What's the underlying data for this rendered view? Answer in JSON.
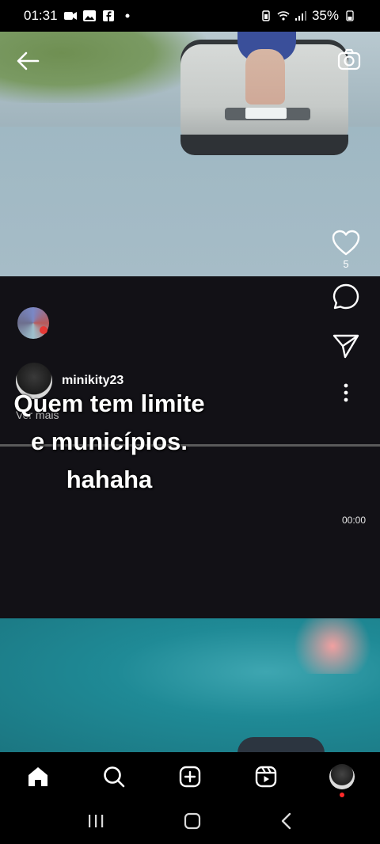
{
  "status_bar": {
    "time": "01:31",
    "battery": "35%"
  },
  "reel": {
    "like_count": "5",
    "username": "minikity23",
    "see_more": "Ver mais",
    "caption_lines": [
      "Quem tem limite",
      "e municípios.",
      "hahaha"
    ],
    "timestamp": "00:00"
  },
  "icons": {
    "back": "arrow-left-icon",
    "camera": "camera-icon",
    "like": "heart-icon",
    "comment": "comment-icon",
    "share": "send-icon",
    "more": "more-vertical-icon",
    "home": "home-icon",
    "search": "search-icon",
    "create": "plus-square-icon",
    "reels": "reels-icon"
  }
}
